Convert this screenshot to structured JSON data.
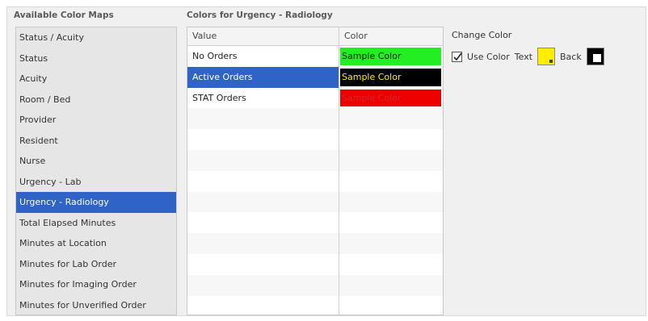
{
  "headings": {
    "available_maps": "Available Color Maps",
    "colors_for": "Colors for Urgency - Radiology"
  },
  "color_maps": [
    {
      "label": "Status / Acuity",
      "selected": false
    },
    {
      "label": "Status",
      "selected": false
    },
    {
      "label": "Acuity",
      "selected": false
    },
    {
      "label": "Room / Bed",
      "selected": false
    },
    {
      "label": "Provider",
      "selected": false
    },
    {
      "label": "Resident",
      "selected": false
    },
    {
      "label": "Nurse",
      "selected": false
    },
    {
      "label": "Urgency - Lab",
      "selected": false
    },
    {
      "label": "Urgency - Radiology",
      "selected": true
    },
    {
      "label": "Total Elapsed Minutes",
      "selected": false
    },
    {
      "label": "Minutes at Location",
      "selected": false
    },
    {
      "label": "Minutes for Lab Order",
      "selected": false
    },
    {
      "label": "Minutes for Imaging Order",
      "selected": false
    },
    {
      "label": "Minutes for Unverified Order",
      "selected": false
    }
  ],
  "table": {
    "columns": [
      "Value",
      "Color"
    ],
    "rows": [
      {
        "value": "No Orders",
        "sample": "Sample Color",
        "bg": "#22ee22",
        "fg": "#1a1a1a",
        "selected": false
      },
      {
        "value": "Active Orders",
        "sample": "Sample Color",
        "bg": "#000000",
        "fg": "#ffee00",
        "selected": true
      },
      {
        "value": "STAT Orders",
        "sample": "Sample Color",
        "bg": "#ee0000",
        "fg": "#cc2a2a",
        "selected": false
      }
    ]
  },
  "change_color": {
    "title": "Change Color",
    "use_color_label": "Use Color",
    "use_color_checked": true,
    "text_label": "Text",
    "text_color": "#ffee00",
    "back_label": "Back",
    "back_color": "#000000"
  }
}
